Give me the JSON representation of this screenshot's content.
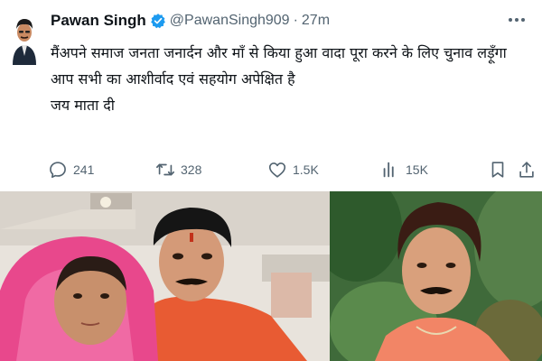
{
  "tweet": {
    "author_name": "Pawan Singh",
    "handle": "@PawanSingh909",
    "separator": "·",
    "time": "27m",
    "lines": [
      "मैंअपने समाज जनता जनार्दन और माँ से किया हुआ वादा पूरा करने के लिए चुनाव लड़ूँगा",
      "आप सभी का आशीर्वाद एवं सहयोग अपेक्षित है",
      "जय माता दी"
    ],
    "stats": {
      "replies": "241",
      "retweets": "328",
      "likes": "1.5K",
      "views": "15K"
    },
    "icons": {
      "avatar": "avatar",
      "verified": "verified-badge-icon",
      "more": "more-options-icon",
      "reply": "reply-icon",
      "retweet": "retweet-icon",
      "like": "heart-icon",
      "views": "views-bar-chart-icon",
      "bookmark": "bookmark-icon",
      "share": "share-icon"
    },
    "colors": {
      "text": "#0f1419",
      "muted": "#536471",
      "verified_blue": "#1d9bf0"
    }
  },
  "photos": [
    {
      "name": "photo-with-mother"
    },
    {
      "name": "portrait-photo"
    }
  ]
}
